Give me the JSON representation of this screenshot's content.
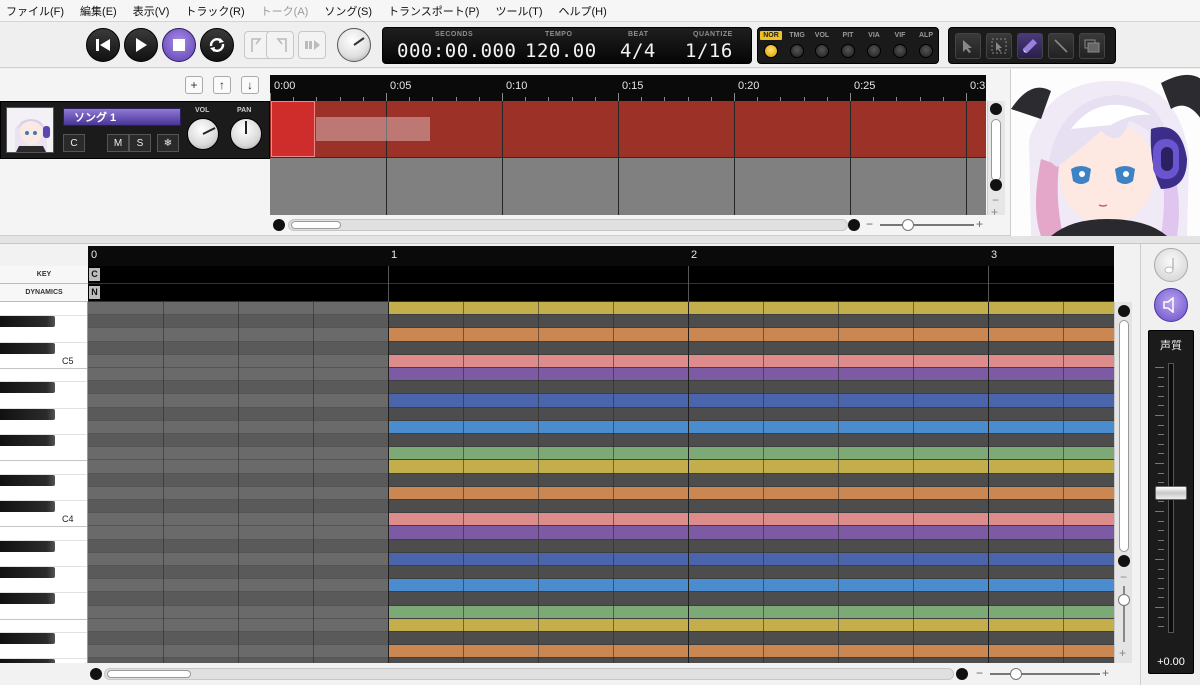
{
  "menu": [
    "ファイル(F)",
    "編集(E)",
    "表示(V)",
    "トラック(R)",
    "トーク(A)",
    "ソング(S)",
    "トランスポート(P)",
    "ツール(T)",
    "ヘルプ(H)"
  ],
  "transport": {
    "buttons": [
      "rewind",
      "play",
      "stop",
      "loop"
    ],
    "active": "stop",
    "lcd": {
      "seconds_label": "SECONDS",
      "seconds": "000:00.000",
      "tempo_label": "TEMPO",
      "tempo": "120.00",
      "beat_label": "BEAT",
      "beat": "4/4",
      "quantize_label": "QUANTIZE",
      "quantize": "1/16"
    },
    "modes": [
      {
        "label": "NOR",
        "on": true
      },
      {
        "label": "TMG",
        "on": false
      },
      {
        "label": "VOL",
        "on": false
      },
      {
        "label": "PIT",
        "on": false
      },
      {
        "label": "VIA",
        "on": false
      },
      {
        "label": "VIF",
        "on": false
      },
      {
        "label": "ALP",
        "on": false
      }
    ],
    "tools": [
      "arrow-tool-icon",
      "select-tool-icon",
      "pencil-tool-icon",
      "line-tool-icon",
      "multi-window-icon"
    ]
  },
  "track": {
    "controls": [
      "+",
      "↑",
      "↓"
    ],
    "name": "ソング 1",
    "buttons": [
      "C",
      "M",
      "S",
      "❄"
    ],
    "vol_label": "VOL",
    "pan_label": "PAN",
    "clip_color": "#9c3128"
  },
  "timeline": {
    "ticks": [
      "0:00",
      "0:05",
      "0:10",
      "0:15",
      "0:20",
      "0:25",
      "0:3"
    ],
    "zoom_minus": "−",
    "zoom_plus": "+"
  },
  "pianoroll": {
    "bars": [
      "0",
      "1",
      "2",
      "3"
    ],
    "lanes": [
      {
        "label": "KEY",
        "tag": "C"
      },
      {
        "label": "DYNAMICS",
        "tag": "N"
      }
    ],
    "key_labels": [
      "C5",
      "C4"
    ],
    "scale_colors": [
      "#7e5aa8",
      "#4a66b2",
      "#4a8fd4",
      "#7fae78",
      "#c9b34a",
      "#d18a52",
      "#e58e8e"
    ],
    "zoom_minus": "−",
    "zoom_plus": "+"
  },
  "mixer": {
    "title": "声質",
    "value": "+0.00",
    "fader_level": 0.52
  }
}
